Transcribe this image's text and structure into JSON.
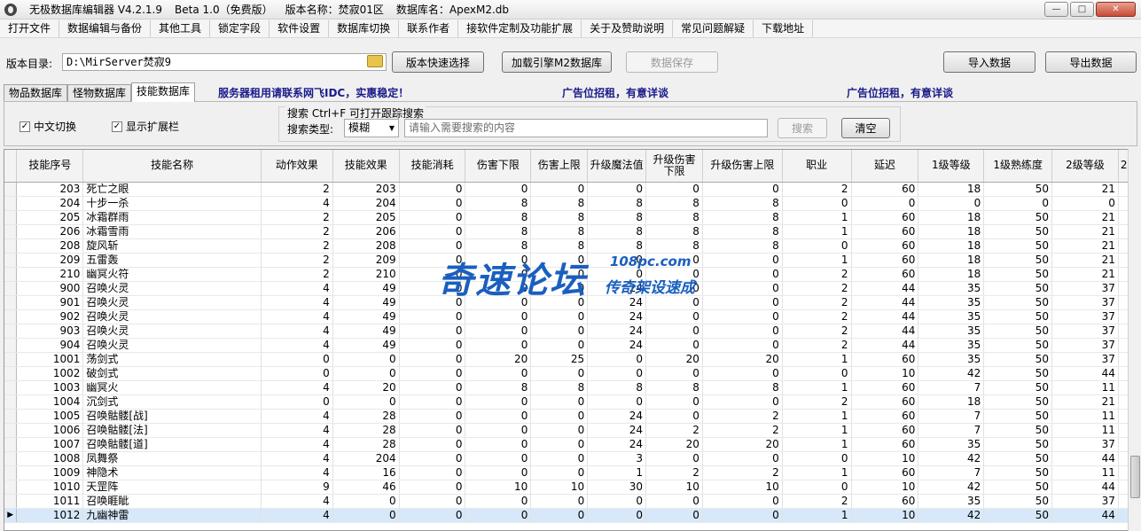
{
  "title": {
    "app": "无极数据库编辑器 V4.2.1.9",
    "beta": "Beta 1.0（免费版）",
    "version_name": "版本名称：焚寂01区",
    "db_name": "数据库名：ApexM2.db"
  },
  "window_buttons": {
    "minimize": "—",
    "maximize": "□",
    "close": "✕"
  },
  "menu": [
    "打开文件",
    "数据编辑与备份",
    "其他工具",
    "锁定字段",
    "软件设置",
    "数据库切换",
    "联系作者",
    "接软件定制及功能扩展",
    "关于及赞助说明",
    "常见问题解疑",
    "下载地址"
  ],
  "toolbar": {
    "dir_label": "版本目录:",
    "dir_value": "D:\\MirServer焚寂9",
    "quick_select": "版本快速选择",
    "load_engine": "加载引擎M2数据库",
    "save_data": "数据保存",
    "import": "导入数据",
    "export": "导出数据"
  },
  "tabs": [
    "物品数据库",
    "怪物数据库",
    "技能数据库"
  ],
  "ads": {
    "server": "服务器租用请联系网飞IDC，实惠稳定！",
    "ad1": "广告位招租，有意详谈",
    "ad2": "广告位招租，有意详谈"
  },
  "options": {
    "chinese_switch": "中文切换",
    "show_ext": "显示扩展栏"
  },
  "search": {
    "title": "搜索  Ctrl+F 可打开跟踪搜索",
    "type_label": "搜索类型:",
    "type_value": "模糊",
    "placeholder": "请输入需要搜索的内容",
    "search_btn": "搜索",
    "clear_btn": "清空"
  },
  "grid": {
    "columns": [
      "技能序号",
      "技能名称",
      "动作效果",
      "技能效果",
      "技能消耗",
      "伤害下限",
      "伤害上限",
      "升级魔法值",
      "升级伤害下限",
      "升级伤害上限",
      "职业",
      "延迟",
      "1级等级",
      "1级熟练度",
      "2级等级",
      "2"
    ],
    "rows": [
      [
        "203",
        "死亡之眼",
        "2",
        "203",
        "0",
        "0",
        "0",
        "0",
        "0",
        "0",
        "2",
        "60",
        "18",
        "50",
        "21"
      ],
      [
        "204",
        "十步一杀",
        "4",
        "204",
        "0",
        "8",
        "8",
        "8",
        "8",
        "8",
        "0",
        "0",
        "0",
        "0",
        "0"
      ],
      [
        "205",
        "冰霜群雨",
        "2",
        "205",
        "0",
        "8",
        "8",
        "8",
        "8",
        "8",
        "1",
        "60",
        "18",
        "50",
        "21"
      ],
      [
        "206",
        "冰霜雪雨",
        "2",
        "206",
        "0",
        "8",
        "8",
        "8",
        "8",
        "8",
        "1",
        "60",
        "18",
        "50",
        "21"
      ],
      [
        "208",
        "旋风斩",
        "2",
        "208",
        "0",
        "8",
        "8",
        "8",
        "8",
        "8",
        "0",
        "60",
        "18",
        "50",
        "21"
      ],
      [
        "209",
        "五雷轰",
        "2",
        "209",
        "0",
        "0",
        "0",
        "0",
        "0",
        "0",
        "1",
        "60",
        "18",
        "50",
        "21"
      ],
      [
        "210",
        "幽冥火符",
        "2",
        "210",
        "0",
        "0",
        "0",
        "0",
        "0",
        "0",
        "2",
        "60",
        "18",
        "50",
        "21"
      ],
      [
        "900",
        "召唤火灵",
        "4",
        "49",
        "0",
        "0",
        "0",
        "24",
        "0",
        "0",
        "2",
        "44",
        "35",
        "50",
        "37"
      ],
      [
        "901",
        "召唤火灵",
        "4",
        "49",
        "0",
        "0",
        "0",
        "24",
        "0",
        "0",
        "2",
        "44",
        "35",
        "50",
        "37"
      ],
      [
        "902",
        "召唤火灵",
        "4",
        "49",
        "0",
        "0",
        "0",
        "24",
        "0",
        "0",
        "2",
        "44",
        "35",
        "50",
        "37"
      ],
      [
        "903",
        "召唤火灵",
        "4",
        "49",
        "0",
        "0",
        "0",
        "24",
        "0",
        "0",
        "2",
        "44",
        "35",
        "50",
        "37"
      ],
      [
        "904",
        "召唤火灵",
        "4",
        "49",
        "0",
        "0",
        "0",
        "24",
        "0",
        "0",
        "2",
        "44",
        "35",
        "50",
        "37"
      ],
      [
        "1001",
        "荡剑式",
        "0",
        "0",
        "0",
        "20",
        "25",
        "0",
        "20",
        "20",
        "1",
        "60",
        "35",
        "50",
        "37"
      ],
      [
        "1002",
        "破剑式",
        "0",
        "0",
        "0",
        "0",
        "0",
        "0",
        "0",
        "0",
        "0",
        "10",
        "42",
        "50",
        "44"
      ],
      [
        "1003",
        "幽冥火",
        "4",
        "20",
        "0",
        "8",
        "8",
        "8",
        "8",
        "8",
        "1",
        "60",
        "7",
        "50",
        "11"
      ],
      [
        "1004",
        "沉剑式",
        "0",
        "0",
        "0",
        "0",
        "0",
        "0",
        "0",
        "0",
        "2",
        "60",
        "18",
        "50",
        "21"
      ],
      [
        "1005",
        "召唤骷髅[战]",
        "4",
        "28",
        "0",
        "0",
        "0",
        "24",
        "0",
        "2",
        "1",
        "60",
        "7",
        "50",
        "11"
      ],
      [
        "1006",
        "召唤骷髅[法]",
        "4",
        "28",
        "0",
        "0",
        "0",
        "24",
        "2",
        "2",
        "1",
        "60",
        "7",
        "50",
        "11"
      ],
      [
        "1007",
        "召唤骷髅[道]",
        "4",
        "28",
        "0",
        "0",
        "0",
        "24",
        "20",
        "20",
        "1",
        "60",
        "35",
        "50",
        "37"
      ],
      [
        "1008",
        "凤舞祭",
        "4",
        "204",
        "0",
        "0",
        "0",
        "3",
        "0",
        "0",
        "0",
        "10",
        "42",
        "50",
        "44"
      ],
      [
        "1009",
        "神隐术",
        "4",
        "16",
        "0",
        "0",
        "0",
        "1",
        "2",
        "2",
        "1",
        "60",
        "7",
        "50",
        "11"
      ],
      [
        "1010",
        "天罡阵",
        "9",
        "46",
        "0",
        "10",
        "10",
        "30",
        "10",
        "10",
        "0",
        "10",
        "42",
        "50",
        "44"
      ],
      [
        "1011",
        "召唤睚眦",
        "4",
        "0",
        "0",
        "0",
        "0",
        "0",
        "0",
        "0",
        "2",
        "60",
        "35",
        "50",
        "37"
      ],
      [
        "1012",
        "九幽神雷",
        "4",
        "0",
        "0",
        "0",
        "0",
        "0",
        "0",
        "0",
        "1",
        "10",
        "42",
        "50",
        "44"
      ]
    ],
    "selected_row": 23
  },
  "watermark": {
    "main": "奇速论坛",
    "url": "108pc.com",
    "sub": "传奇架设速成"
  }
}
